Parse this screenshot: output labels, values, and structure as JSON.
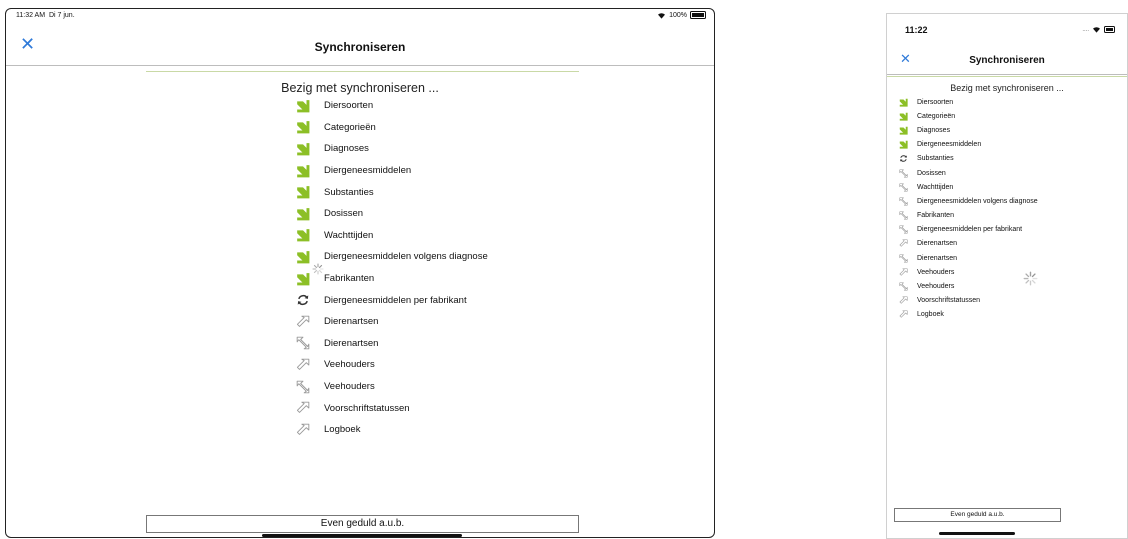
{
  "colors": {
    "accent": "#2f7ad9",
    "done": "#8cbf26",
    "pending": "#9a9a9a",
    "divider": "#c9d9a6"
  },
  "icons": {
    "done": "green-down-arrow-icon",
    "in_progress": "sync-icon",
    "pending": "outline-arrow-icon",
    "close": "close-x-icon",
    "spinner": "loading-spinner-icon"
  },
  "tablet": {
    "status": {
      "time": "11:32 AM",
      "date": "Di 7 jun.",
      "battery": "100%"
    },
    "title": "Synchroniseren",
    "close": "✕",
    "heading": "Bezig met synchroniseren ...",
    "footer": "Even geduld a.u.b.",
    "items": [
      {
        "label": "Diersoorten",
        "state": "done"
      },
      {
        "label": "Categorieën",
        "state": "done"
      },
      {
        "label": "Diagnoses",
        "state": "done"
      },
      {
        "label": "Diergeneesmiddelen",
        "state": "done"
      },
      {
        "label": "Substanties",
        "state": "done"
      },
      {
        "label": "Dosissen",
        "state": "done"
      },
      {
        "label": "Wachttijden",
        "state": "done"
      },
      {
        "label": "Diergeneesmiddelen volgens diagnose",
        "state": "done"
      },
      {
        "label": "Fabrikanten",
        "state": "done"
      },
      {
        "label": "Diergeneesmiddelen per fabrikant",
        "state": "in_progress"
      },
      {
        "label": "Dierenartsen",
        "state": "pending",
        "variant": "up"
      },
      {
        "label": "Dierenartsen",
        "state": "pending",
        "variant": "down"
      },
      {
        "label": "Veehouders",
        "state": "pending",
        "variant": "up"
      },
      {
        "label": "Veehouders",
        "state": "pending",
        "variant": "down"
      },
      {
        "label": "Voorschriftstatussen",
        "state": "pending",
        "variant": "up"
      },
      {
        "label": "Logboek",
        "state": "pending",
        "variant": "up"
      }
    ]
  },
  "phone": {
    "status": {
      "time": "11:22"
    },
    "title": "Synchroniseren",
    "close": "✕",
    "heading": "Bezig met synchroniseren ...",
    "footer": "Even geduld a.u.b.",
    "items": [
      {
        "label": "Diersoorten",
        "state": "done"
      },
      {
        "label": "Categorieën",
        "state": "done"
      },
      {
        "label": "Diagnoses",
        "state": "done"
      },
      {
        "label": "Diergeneesmiddelen",
        "state": "done"
      },
      {
        "label": "Substanties",
        "state": "in_progress"
      },
      {
        "label": "Dosissen",
        "state": "pending",
        "variant": "down"
      },
      {
        "label": "Wachttijden",
        "state": "pending",
        "variant": "down"
      },
      {
        "label": "Diergeneesmiddelen volgens diagnose",
        "state": "pending",
        "variant": "down"
      },
      {
        "label": "Fabrikanten",
        "state": "pending",
        "variant": "down"
      },
      {
        "label": "Diergeneesmiddelen per fabrikant",
        "state": "pending",
        "variant": "down"
      },
      {
        "label": "Dierenartsen",
        "state": "pending",
        "variant": "up"
      },
      {
        "label": "Dierenartsen",
        "state": "pending",
        "variant": "down"
      },
      {
        "label": "Veehouders",
        "state": "pending",
        "variant": "up"
      },
      {
        "label": "Veehouders",
        "state": "pending",
        "variant": "down"
      },
      {
        "label": "Voorschriftstatussen",
        "state": "pending",
        "variant": "up"
      },
      {
        "label": "Logboek",
        "state": "pending",
        "variant": "up"
      }
    ]
  }
}
